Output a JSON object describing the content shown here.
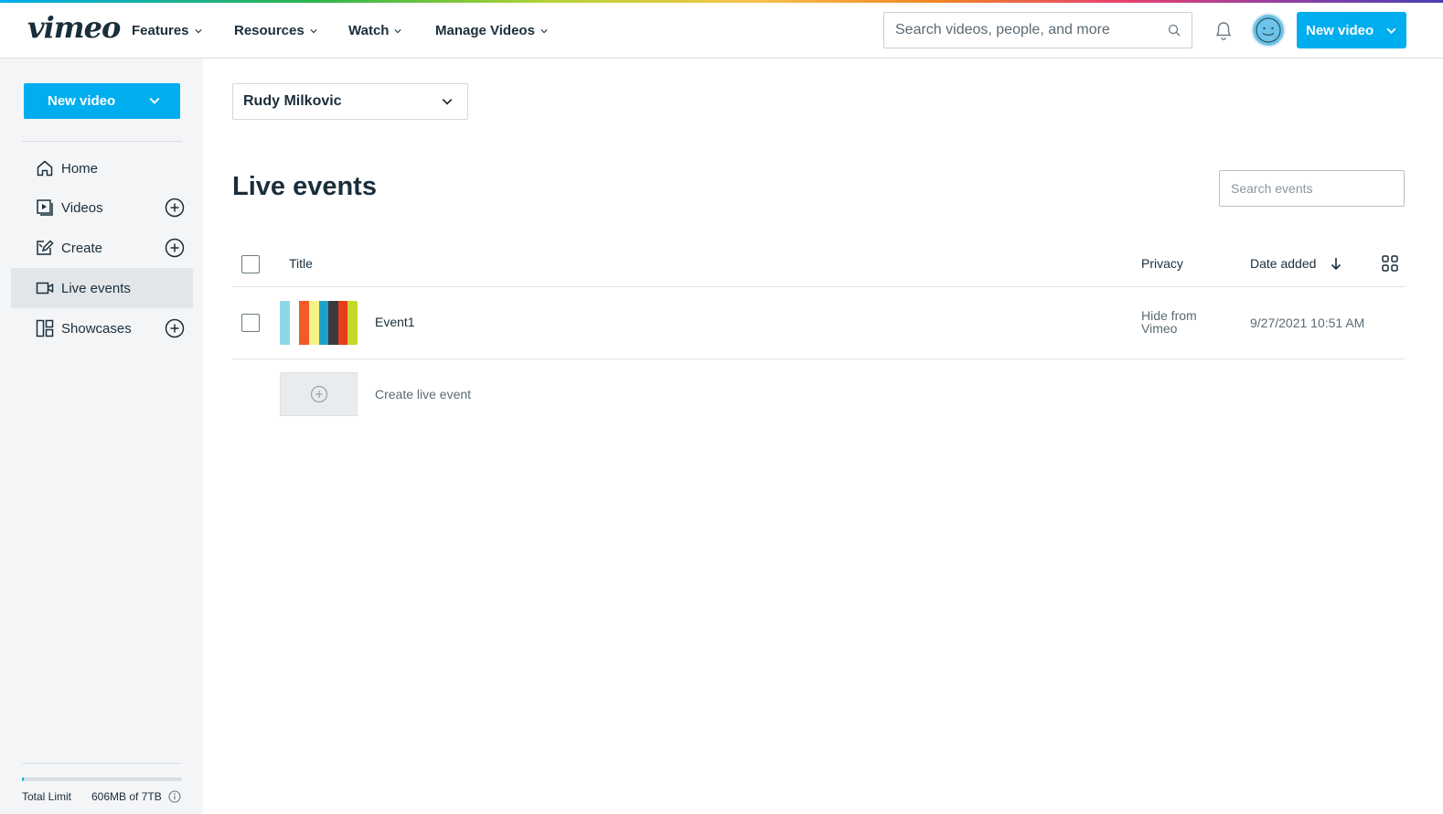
{
  "topnav": {
    "logo": "vimeo",
    "items": [
      "Features",
      "Resources",
      "Watch",
      "Manage Videos"
    ],
    "search_placeholder": "Search videos, people, and more",
    "new_video_label": "New video"
  },
  "sidebar": {
    "new_video_label": "New video",
    "items": [
      {
        "label": "Home",
        "icon": "home-icon"
      },
      {
        "label": "Videos",
        "icon": "videos-icon"
      },
      {
        "label": "Create",
        "icon": "create-icon"
      },
      {
        "label": "Live events",
        "icon": "camera-icon"
      },
      {
        "label": "Showcases",
        "icon": "showcases-icon"
      }
    ],
    "active": "Live events",
    "storage_label": "Total Limit",
    "storage_value": "606MB of 7TB",
    "storage_fraction": 0.0001
  },
  "main": {
    "account": "Rudy Milkovic",
    "title": "Live events",
    "search_placeholder": "Search events",
    "columns": {
      "title": "Title",
      "privacy": "Privacy",
      "date": "Date added"
    },
    "rows": [
      {
        "title": "Event1",
        "privacy": "Hide from Vimeo",
        "date": "9/27/2021 10:51 AM",
        "thumb_colors": [
          "#8dd8e6",
          "#ffffff",
          "#f15a29",
          "#f7f28a",
          "#1da1c8",
          "#3a3a3a",
          "#e63e1c",
          "#c8d82a"
        ]
      }
    ],
    "create_label": "Create live event"
  },
  "colors": {
    "accent": "#00adef",
    "text": "#1a2e3b",
    "sidebar_bg": "#f4f5f7"
  }
}
